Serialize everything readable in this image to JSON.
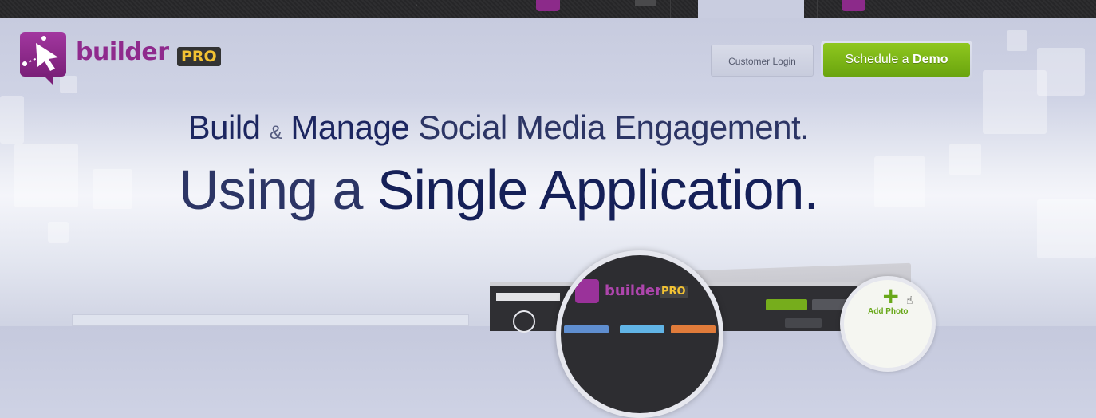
{
  "brand": {
    "name": "builder",
    "badge": "PRO",
    "colors": {
      "purple": "#8f2a8d",
      "badge_text": "#f2c233",
      "green": "#76ad1c"
    }
  },
  "header": {
    "login_label": "Customer Login",
    "demo_prefix": "Schedule a ",
    "demo_bold": "Demo"
  },
  "hero": {
    "line1": {
      "w1": "Build",
      "amp": "&",
      "w2": "Manage",
      "rest": "Social Media Engagement."
    },
    "line2": {
      "light": "Using a",
      "strong": "Single Application."
    }
  },
  "preview": {
    "lens_brand": "builder",
    "lens_badge": "PRO",
    "add_photo": "Add Photo"
  },
  "icons": {
    "logo": "cursor-speech-bubble-icon",
    "plus": "plus-icon",
    "cursor": "hand-cursor-icon"
  }
}
